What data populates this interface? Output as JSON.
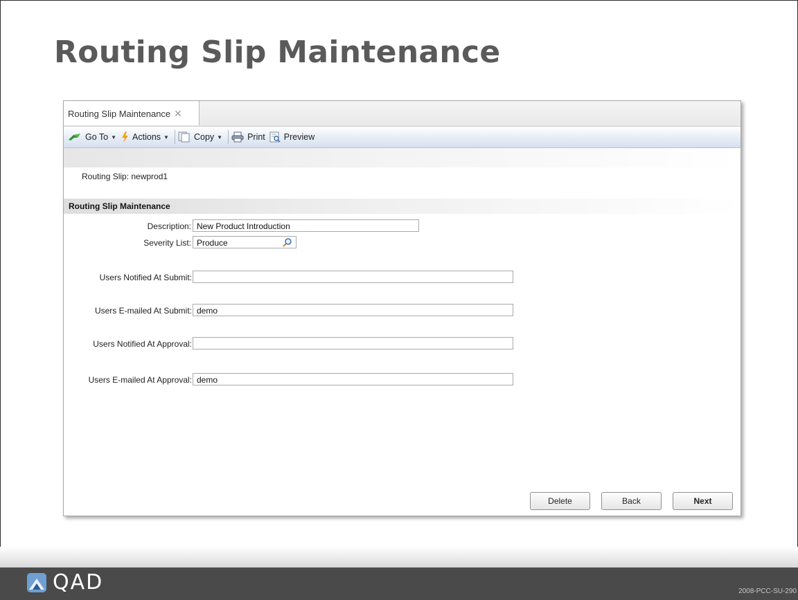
{
  "slide": {
    "title": "Routing Slip Maintenance",
    "code": "2008-PCC-SU-290"
  },
  "window": {
    "tab_label": "Routing Slip Maintenance",
    "tab_close": "✕"
  },
  "toolbar": {
    "goto_label": "Go To",
    "actions_label": "Actions",
    "copy_label": "Copy",
    "print_label": "Print",
    "preview_label": "Preview"
  },
  "record": {
    "slip_line": "Routing Slip:  newprod1"
  },
  "form": {
    "section_title": "Routing Slip Maintenance",
    "description_label": "Description:",
    "description_value": "New Product Introduction",
    "severity_label": "Severity List:",
    "severity_value": "Produce",
    "notified_submit_label": "Users Notified At Submit:",
    "notified_submit_value": "",
    "emailed_submit_label": "Users E-mailed At Submit:",
    "emailed_submit_value": "demo",
    "notified_approval_label": "Users Notified At Approval:",
    "notified_approval_value": "",
    "emailed_approval_label": "Users E-mailed At Approval:",
    "emailed_approval_value": "demo"
  },
  "buttons": {
    "delete": "Delete",
    "back": "Back",
    "next": "Next"
  },
  "footer": {
    "logo_text": "QAD"
  },
  "icons": {
    "goto": "green-arrow-icon",
    "actions": "lightning-icon",
    "copy": "copy-icon",
    "print": "printer-icon",
    "preview": "preview-icon",
    "lookup": "magnifier-icon",
    "logo": "qad-logo-icon"
  },
  "colors": {
    "footer_bg": "#4a4a4a",
    "toolbar_bg": "#dfe7f2",
    "title_text": "#5a5a5a"
  }
}
